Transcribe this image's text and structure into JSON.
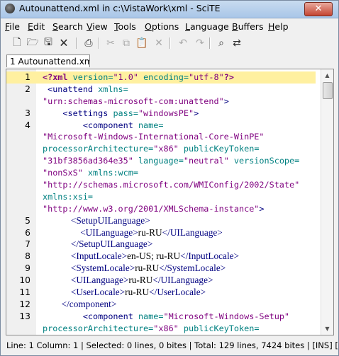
{
  "window": {
    "title": "Autounattend.xml in c:\\VistaWork\\xml - SciTE",
    "close_glyph": "✕"
  },
  "menu": [
    {
      "label": "File",
      "ul": "F",
      "rest": "ile"
    },
    {
      "label": "Edit",
      "ul": "E",
      "rest": "dit"
    },
    {
      "label": "Search",
      "ul": "S",
      "rest": "earch"
    },
    {
      "label": "View",
      "ul": "V",
      "rest": "iew"
    },
    {
      "label": "Tools",
      "ul": "T",
      "rest": "ools"
    },
    {
      "label": "Options",
      "ul": "O",
      "rest": "ptions"
    },
    {
      "label": "Language",
      "ul": "L",
      "rest": "anguage"
    },
    {
      "label": "Buffers",
      "ul": "B",
      "rest": "uffers"
    },
    {
      "label": "Help",
      "ul": "H",
      "rest": "elp"
    }
  ],
  "toolbar": {
    "icons": [
      "new-document-icon",
      "open-folder-icon",
      "save-icon",
      "close-document-icon",
      "print-icon",
      "cut-icon",
      "copy-icon",
      "paste-icon",
      "delete-icon",
      "undo-icon",
      "redo-icon",
      "find-icon",
      "replace-icon"
    ]
  },
  "tab": {
    "label": "1 Autounattend.xml"
  },
  "editor": {
    "lines": [
      {
        "num": "1",
        "segs": [
          {
            "t": "<?xml ",
            "c": "pi"
          },
          {
            "t": "version=",
            "c": "attr"
          },
          {
            "t": "\"1.0\"",
            "c": "str"
          },
          {
            "t": " encoding=",
            "c": "attr"
          },
          {
            "t": "\"utf-8\"",
            "c": "str"
          },
          {
            "t": "?>",
            "c": "pi"
          }
        ]
      },
      {
        "num": "2",
        "segs": [
          {
            "t": " <unattend ",
            "c": "tag"
          },
          {
            "t": "xmlns=",
            "c": "attr"
          }
        ]
      },
      {
        "num": "",
        "segs": [
          {
            "t": "\"urn:schemas-microsoft-com:unattend\"",
            "c": "str"
          },
          {
            "t": ">",
            "c": "tag"
          }
        ]
      },
      {
        "num": "3",
        "segs": [
          {
            "t": "    <settings ",
            "c": "tag"
          },
          {
            "t": "pass=",
            "c": "attr"
          },
          {
            "t": "\"windowsPE\"",
            "c": "str"
          },
          {
            "t": ">",
            "c": "tag"
          }
        ]
      },
      {
        "num": "4",
        "segs": [
          {
            "t": "        <component ",
            "c": "tag"
          },
          {
            "t": "name=",
            "c": "attr"
          }
        ]
      },
      {
        "num": "",
        "segs": [
          {
            "t": "\"Microsoft-Windows-International-Core-WinPE\"",
            "c": "str"
          }
        ]
      },
      {
        "num": "",
        "segs": [
          {
            "t": "processorArchitecture=",
            "c": "attr"
          },
          {
            "t": "\"x86\"",
            "c": "str"
          },
          {
            "t": " publicKeyToken=",
            "c": "attr"
          }
        ]
      },
      {
        "num": "",
        "segs": [
          {
            "t": "\"31bf3856ad364e35\"",
            "c": "str"
          },
          {
            "t": " language=",
            "c": "attr"
          },
          {
            "t": "\"neutral\"",
            "c": "str"
          },
          {
            "t": " versionScope=",
            "c": "attr"
          }
        ]
      },
      {
        "num": "",
        "segs": [
          {
            "t": "\"nonSxS\"",
            "c": "str"
          },
          {
            "t": " xmlns:wcm=",
            "c": "attr"
          }
        ]
      },
      {
        "num": "",
        "segs": [
          {
            "t": "\"http://schemas.microsoft.com/WMIConfig/2002/State\"",
            "c": "str"
          }
        ]
      },
      {
        "num": "",
        "segs": [
          {
            "t": "xmlns:xsi=",
            "c": "attr"
          }
        ]
      },
      {
        "num": "",
        "segs": [
          {
            "t": "\"http://www.w3.org/2001/XMLSchema-instance\"",
            "c": "str"
          },
          {
            "t": ">",
            "c": "tag"
          }
        ]
      },
      {
        "num": "5",
        "serif": true,
        "segs": [
          {
            "t": "            <SetupUILanguage>",
            "c": "tag"
          }
        ]
      },
      {
        "num": "6",
        "serif": true,
        "segs": [
          {
            "t": "                <UILanguage>",
            "c": "tag"
          },
          {
            "t": "ru-RU",
            "c": "txt"
          },
          {
            "t": "</UILanguage>",
            "c": "tag"
          }
        ]
      },
      {
        "num": "7",
        "serif": true,
        "segs": [
          {
            "t": "            </SetupUILanguage>",
            "c": "tag"
          }
        ]
      },
      {
        "num": "8",
        "serif": true,
        "segs": [
          {
            "t": "            <InputLocale>",
            "c": "tag"
          },
          {
            "t": "en-US; ru-RU",
            "c": "txt"
          },
          {
            "t": "</InputLocale>",
            "c": "tag"
          }
        ]
      },
      {
        "num": "9",
        "serif": true,
        "segs": [
          {
            "t": "            <SystemLocale>",
            "c": "tag"
          },
          {
            "t": "ru-RU",
            "c": "txt"
          },
          {
            "t": "</SystemLocale>",
            "c": "tag"
          }
        ]
      },
      {
        "num": "10",
        "serif": true,
        "segs": [
          {
            "t": "            <UILanguage>",
            "c": "tag"
          },
          {
            "t": "ru-RU",
            "c": "txt"
          },
          {
            "t": "</UILanguage>",
            "c": "tag"
          }
        ]
      },
      {
        "num": "11",
        "serif": true,
        "segs": [
          {
            "t": "            <UserLocale>",
            "c": "tag"
          },
          {
            "t": "ru-RU",
            "c": "txt"
          },
          {
            "t": "</UserLocale>",
            "c": "tag"
          }
        ]
      },
      {
        "num": "12",
        "serif": true,
        "segs": [
          {
            "t": "        </component>",
            "c": "tag"
          }
        ]
      },
      {
        "num": "13",
        "segs": [
          {
            "t": "        <component ",
            "c": "tag"
          },
          {
            "t": "name=",
            "c": "attr"
          },
          {
            "t": "\"Microsoft-Windows-Setup\"",
            "c": "str"
          }
        ]
      },
      {
        "num": "",
        "segs": [
          {
            "t": "processorArchitecture=",
            "c": "attr"
          },
          {
            "t": "\"x86\"",
            "c": "str"
          },
          {
            "t": " publicKeyToken=",
            "c": "attr"
          }
        ]
      }
    ]
  },
  "status": {
    "text": "Line: 1 Column: 1  |  Selected: 0 lines, 0 bites  |  Total: 129 lines, 7424 bites  |  [INS]  [px"
  }
}
